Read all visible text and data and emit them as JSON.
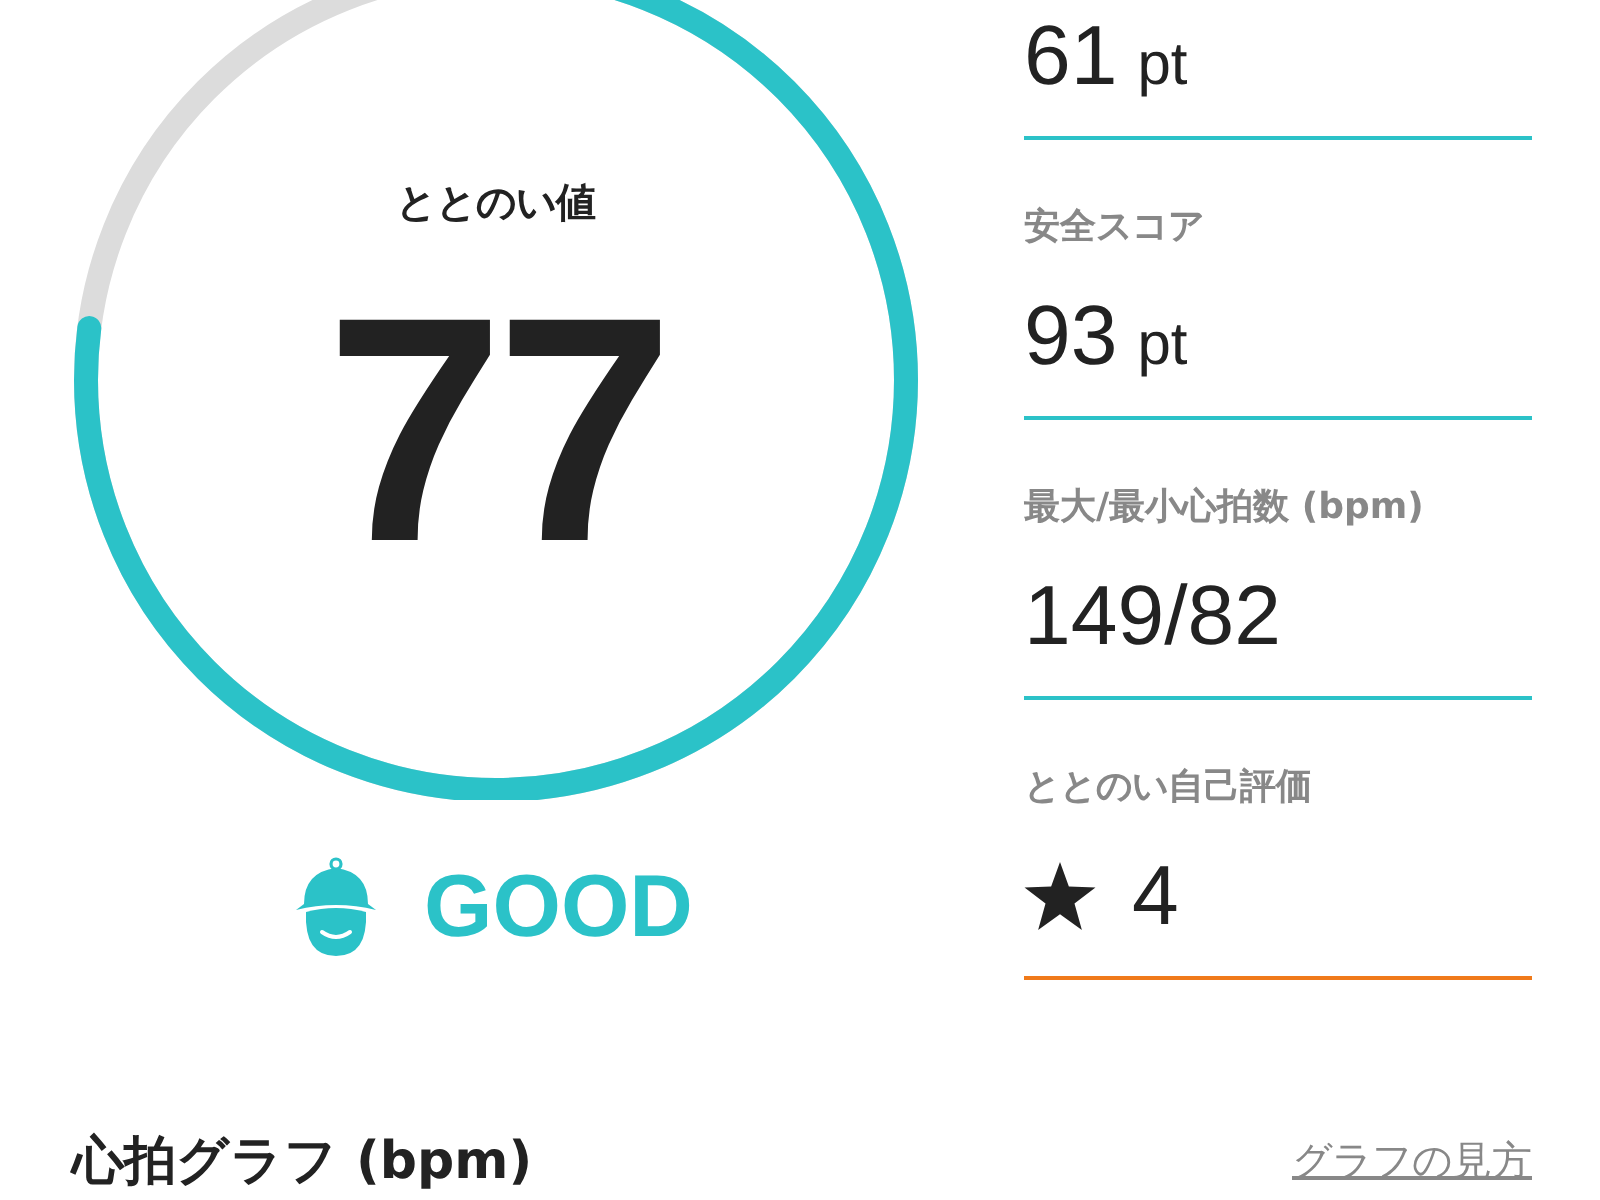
{
  "gauge": {
    "label": "ととのい値",
    "value": "77"
  },
  "status": {
    "text": "GOOD"
  },
  "metrics": [
    {
      "value": "61",
      "unit": "pt",
      "color": "#2bc2c8"
    },
    {
      "label": "安全スコア",
      "value": "93",
      "unit": "pt",
      "color": "#2bc2c8"
    },
    {
      "label": "最大/最小心拍数 (bpm)",
      "value": "149/82",
      "color": "#2bc2c8"
    },
    {
      "kind": "rating",
      "label": "ととのい自己評価",
      "value": "4",
      "color": "#f07a1a"
    }
  ],
  "section": {
    "title": "心拍グラフ (bpm)",
    "link": "グラフの見方"
  }
}
